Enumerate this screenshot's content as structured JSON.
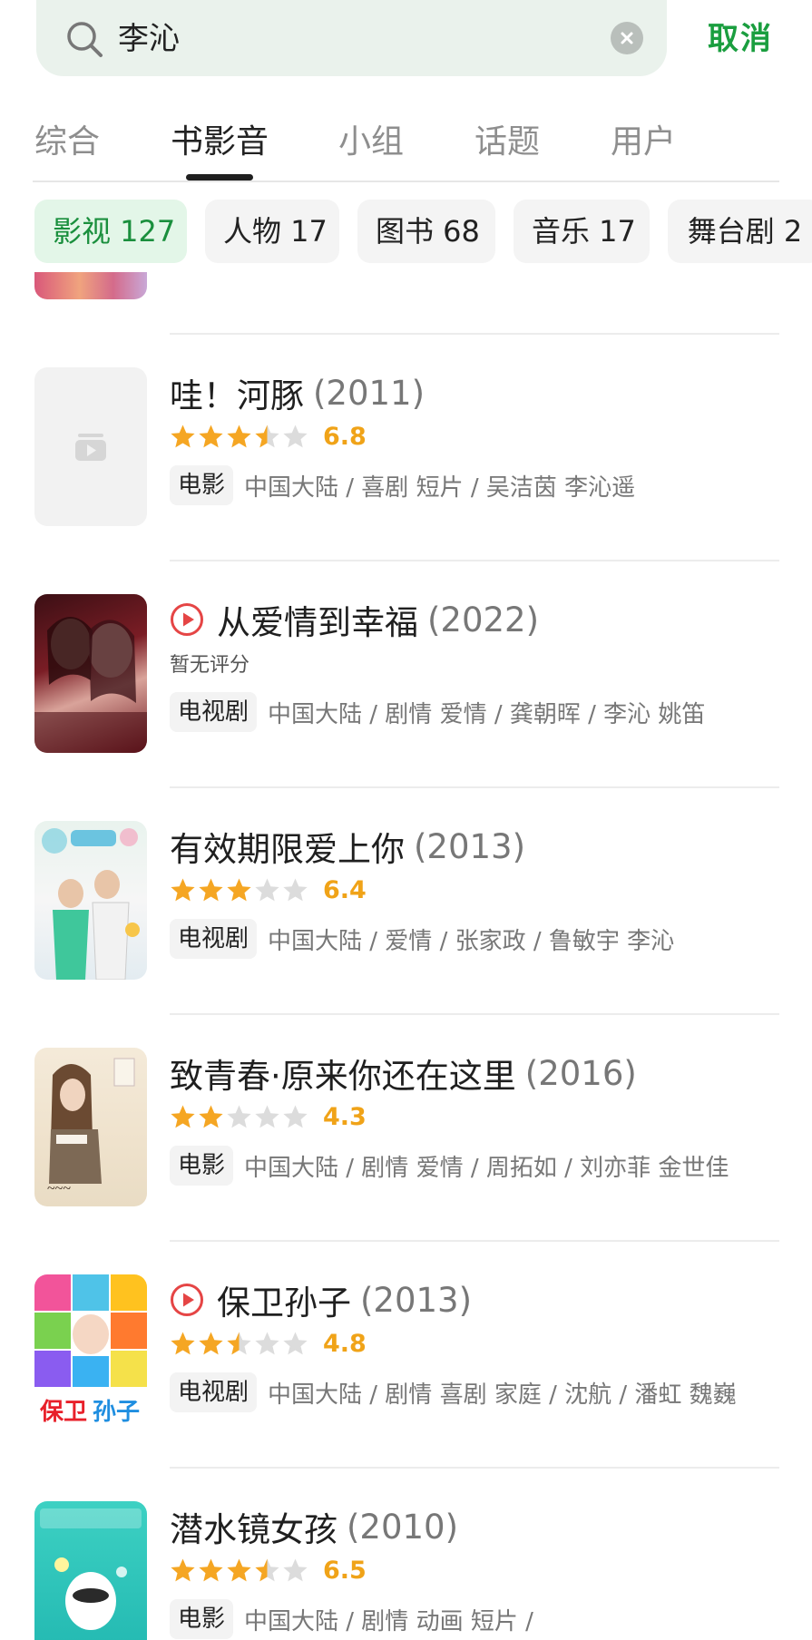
{
  "search": {
    "query": "李沁",
    "cancel_label": "取消"
  },
  "tabs": [
    {
      "label": "综合"
    },
    {
      "label": "书影音"
    },
    {
      "label": "小组"
    },
    {
      "label": "话题"
    },
    {
      "label": "用户"
    }
  ],
  "active_tab": "书影音",
  "chips": [
    {
      "label": "影视 127"
    },
    {
      "label": "人物 17"
    },
    {
      "label": "图书 68"
    },
    {
      "label": "音乐 17"
    },
    {
      "label": "舞台剧 2"
    }
  ],
  "active_chip": "影视 127",
  "colors": {
    "accent_green": "#1a9e3f",
    "star_gold": "#f5a623",
    "play_red": "#e54545"
  },
  "results": [
    {
      "title": "哇！河豚",
      "year": "(2011)",
      "rating": 3.5,
      "score": "6.8",
      "type": "电影",
      "meta": "中国大陆 / 喜剧 短片 / 吴洁茵 李沁遥",
      "poster_icon": "video-placeholder-icon",
      "has_play": false
    },
    {
      "title": "从爱情到幸福",
      "year": "(2022)",
      "rating": null,
      "score": "",
      "no_rating_label": "暂无评分",
      "type": "电视剧",
      "meta": "中国大陆 / 剧情 爱情 / 龚朝晖 / 李沁 姚笛",
      "has_play": true
    },
    {
      "title": "有效期限爱上你",
      "year": "(2013)",
      "rating": 3,
      "score": "6.4",
      "type": "电视剧",
      "meta": "中国大陆 / 爱情 / 张家政 / 鲁敏宇 李沁",
      "has_play": false
    },
    {
      "title": "致青春·原来你还在这里",
      "year": "(2016)",
      "rating": 2,
      "score": "4.3",
      "type": "电影",
      "meta": "中国大陆 / 剧情 爱情 / 周拓如 / 刘亦菲 金世佳",
      "has_play": false
    },
    {
      "title": "保卫孙子",
      "year": "(2013)",
      "rating": 2.5,
      "score": "4.8",
      "type": "电视剧",
      "meta": "中国大陆 / 剧情 喜剧 家庭 / 沈航 / 潘虹 魏巍",
      "has_play": true
    },
    {
      "title": "潜水镜女孩",
      "year": "(2010)",
      "rating": 3.5,
      "score": "6.5",
      "type": "电影",
      "meta": "中国大陆 / 剧情 动画 短片 /",
      "has_play": false
    }
  ]
}
